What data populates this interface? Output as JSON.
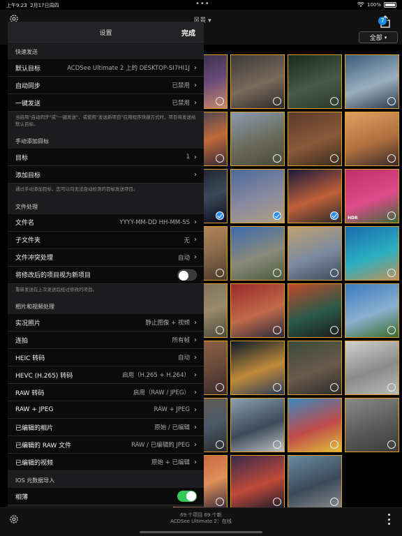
{
  "status_bar": {
    "time": "上午9:23",
    "date": "2月17日周四",
    "battery": "100%"
  },
  "header": {
    "album_title": "风景",
    "badge_count": "7",
    "filter_label": "全部"
  },
  "settings": {
    "title": "设置",
    "done_label": "完成",
    "sections": [
      {
        "header": "快速发送",
        "rows": [
          {
            "label": "默认目标",
            "value": "ACDSee Ultimate 2 上的 DESKTOP-SI7HI1J",
            "type": "nav"
          },
          {
            "label": "自动同步",
            "value": "已禁用",
            "type": "nav"
          },
          {
            "label": "一键发送",
            "value": "已禁用",
            "type": "nav"
          }
        ],
        "footnote": "当启用\"自动同步\"或\"一键发送\"，或使用\"发送新项目\"应用程序快捷方式时，项目将发送给默认目标。"
      },
      {
        "header": "手动添加目标",
        "rows": [
          {
            "label": "目标",
            "value": "1",
            "type": "nav"
          },
          {
            "label": "添加目标",
            "value": "",
            "type": "nav"
          }
        ],
        "footnote": "通过手动添加目标，您可以向无法自动检测的目标发送项目。"
      },
      {
        "header": "文件处理",
        "rows": [
          {
            "label": "文件名",
            "value": "YYYY-MM-DD HH-MM-SS",
            "type": "nav"
          },
          {
            "label": "子文件夹",
            "value": "无",
            "type": "nav"
          },
          {
            "label": "文件冲突处理",
            "value": "自动",
            "type": "nav"
          },
          {
            "label": "将修改后的项目视为新项目",
            "value": "",
            "type": "toggle",
            "on": false
          }
        ],
        "footnote": "重新发送在上次发送后经过修改的项目。"
      },
      {
        "header": "相片和视频处理",
        "rows": [
          {
            "label": "实况照片",
            "value": "静止图像 + 视频",
            "type": "nav"
          },
          {
            "label": "连拍",
            "value": "所有帧",
            "type": "nav"
          },
          {
            "label": "HEIC 转码",
            "value": "自动",
            "type": "nav"
          },
          {
            "label": "HEVC (H.265) 转码",
            "value": "启用（H.265 + H.264）",
            "type": "nav"
          },
          {
            "label": "RAW 转码",
            "value": "启用（RAW / JPEG）",
            "type": "nav"
          },
          {
            "label": "RAW + JPEG",
            "value": "RAW + JPEG",
            "type": "nav"
          },
          {
            "label": "已编辑的相片",
            "value": "原始 / 已编辑",
            "type": "nav"
          },
          {
            "label": "已编辑的 RAW 文件",
            "value": "RAW / 已编辑的 JPEG",
            "type": "nav"
          },
          {
            "label": "已编辑的视频",
            "value": "原始 + 已编辑",
            "type": "nav"
          }
        ],
        "footnote": ""
      },
      {
        "header": "IOS 元数据导入",
        "rows": [
          {
            "label": "相薄",
            "value": "",
            "type": "toggle",
            "on": true
          }
        ],
        "footnote": ""
      }
    ]
  },
  "grid": {
    "tiles": [
      {
        "colors": [
          "#2b2a3a",
          "#6a4a7a",
          "#c98a6a"
        ],
        "selected": false,
        "hdr": false
      },
      {
        "colors": [
          "#3a3a3a",
          "#7a6a5a",
          "#2a2a2a"
        ],
        "selected": false,
        "hdr": false
      },
      {
        "colors": [
          "#1a2a1a",
          "#4a5a4a",
          "#2a3a2a"
        ],
        "selected": false,
        "hdr": false
      },
      {
        "colors": [
          "#3a5a7a",
          "#9ab0c0",
          "#2a3a4a"
        ],
        "selected": false,
        "hdr": false
      },
      {
        "colors": [
          "#2a3a5a",
          "#c06a3a",
          "#3a2a3a"
        ],
        "selected": false,
        "hdr": false
      },
      {
        "colors": [
          "#8a9ab0",
          "#6a6a5a",
          "#4a4a3a"
        ],
        "selected": false,
        "hdr": false
      },
      {
        "colors": [
          "#5a3a2a",
          "#8a5a3a",
          "#3a2a1a"
        ],
        "selected": false,
        "hdr": false
      },
      {
        "colors": [
          "#e0a060",
          "#b07040",
          "#3a2a2a"
        ],
        "selected": false,
        "hdr": false
      },
      {
        "colors": [
          "#1a1a2a",
          "#3a4a5a",
          "#0a0a1a"
        ],
        "selected": true,
        "hdr": false
      },
      {
        "colors": [
          "#4a6a9a",
          "#8a8aa0",
          "#b0a080"
        ],
        "selected": true,
        "hdr": false
      },
      {
        "colors": [
          "#1a1a3a",
          "#c0603a",
          "#2a2a2a"
        ],
        "selected": true,
        "hdr": false
      },
      {
        "colors": [
          "#c0306a",
          "#e04a8a",
          "#3a6a3a"
        ],
        "selected": false,
        "hdr": true
      },
      {
        "colors": [
          "#c09060",
          "#8a6a4a",
          "#4a3a2a"
        ],
        "selected": false,
        "hdr": false
      },
      {
        "colors": [
          "#3a6ab0",
          "#8a8a7a",
          "#4a5a3a"
        ],
        "selected": false,
        "hdr": false
      },
      {
        "colors": [
          "#c0a070",
          "#7a8aa0",
          "#3a4a5a"
        ],
        "selected": false,
        "hdr": false
      },
      {
        "colors": [
          "#1a6ab0",
          "#2ab0c0",
          "#c0905a"
        ],
        "selected": false,
        "hdr": false
      },
      {
        "colors": [
          "#7a6a5a",
          "#9a8a6a",
          "#4a4a3a"
        ],
        "selected": false,
        "hdr": false
      },
      {
        "colors": [
          "#9a2a2a",
          "#c06a4a",
          "#2a2a3a"
        ],
        "selected": false,
        "hdr": false
      },
      {
        "colors": [
          "#c04a2a",
          "#2a5a4a",
          "#1a1a1a"
        ],
        "selected": false,
        "hdr": false
      },
      {
        "colors": [
          "#3a7ac0",
          "#8ab0d0",
          "#3a6a2a"
        ],
        "selected": false,
        "hdr": false
      },
      {
        "colors": [
          "#9a6a4a",
          "#6a4a3a",
          "#3a2a2a"
        ],
        "selected": false,
        "hdr": false
      },
      {
        "colors": [
          "#0a1a2a",
          "#c08a3a",
          "#2a3a5a"
        ],
        "selected": false,
        "hdr": false
      },
      {
        "colors": [
          "#3a4a3a",
          "#6a5a4a",
          "#2a2a2a"
        ],
        "selected": false,
        "hdr": false
      },
      {
        "colors": [
          "#d0d0d0",
          "#8a8a8a",
          "#bababa"
        ],
        "selected": false,
        "hdr": false
      },
      {
        "colors": [
          "#6a5a4a",
          "#4a5a6a",
          "#2a2a2a"
        ],
        "selected": false,
        "hdr": false
      },
      {
        "colors": [
          "#8aa0b0",
          "#3a4a5a",
          "#c0c0c0"
        ],
        "selected": false,
        "hdr": false
      },
      {
        "colors": [
          "#3a8ac0",
          "#c04a4a",
          "#e0c03a"
        ],
        "selected": false,
        "hdr": false
      },
      {
        "colors": [
          "#8a8a8a",
          "#5a5a5a",
          "#3a3a3a"
        ],
        "selected": false,
        "hdr": false
      },
      {
        "colors": [
          "#c05a3a",
          "#e0905a",
          "#3a2a3a"
        ],
        "selected": false,
        "hdr": false
      },
      {
        "colors": [
          "#3a2a4a",
          "#c04a3a",
          "#1a1a2a"
        ],
        "selected": false,
        "hdr": false
      },
      {
        "colors": [
          "#6a8aa0",
          "#3a4a5a",
          "#8a8a8a"
        ],
        "selected": false,
        "hdr": false
      }
    ]
  },
  "footer": {
    "count_line": "69 个项目   69 个新",
    "connection_line": "ACDSee Ultimate 2：在线"
  },
  "colors": {
    "accent_blue": "#2c8cf2",
    "selection_border": "#e0a12a",
    "toggle_on": "#34c759"
  }
}
